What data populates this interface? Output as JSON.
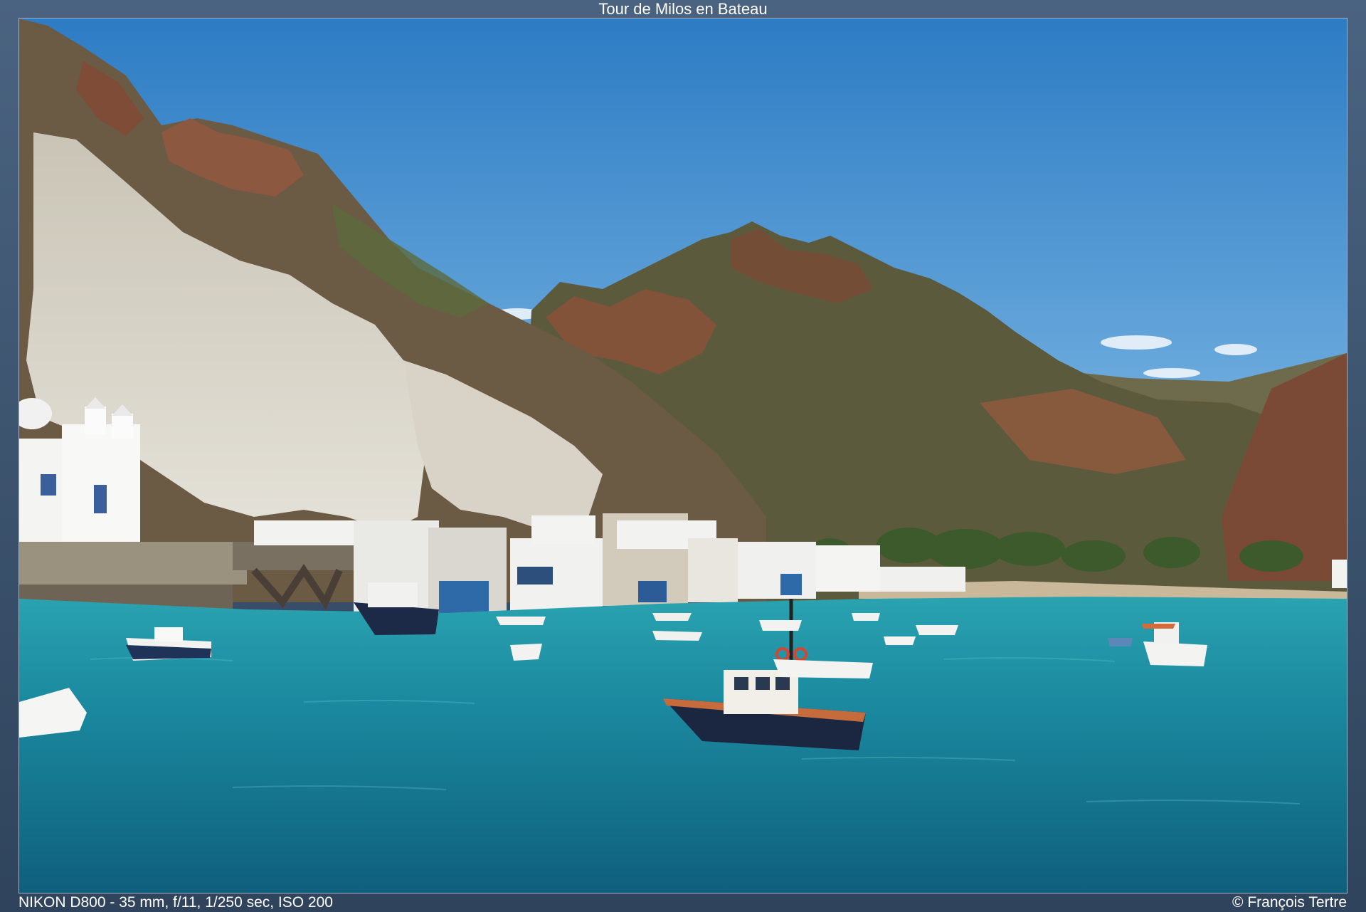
{
  "header": {
    "title": "Tour de Milos en Bateau"
  },
  "footer": {
    "exif": "NIKON D800 - 35 mm, f/11, 1/250 sec, ISO 200",
    "copyright": "© François Tertre"
  },
  "photo": {
    "colors": {
      "sky": "#5fa2d6",
      "sea": "#1f8aa0",
      "rock": "#6d5a45",
      "hill": "#5b5a3e",
      "chalk": "#d9d6cc"
    }
  }
}
